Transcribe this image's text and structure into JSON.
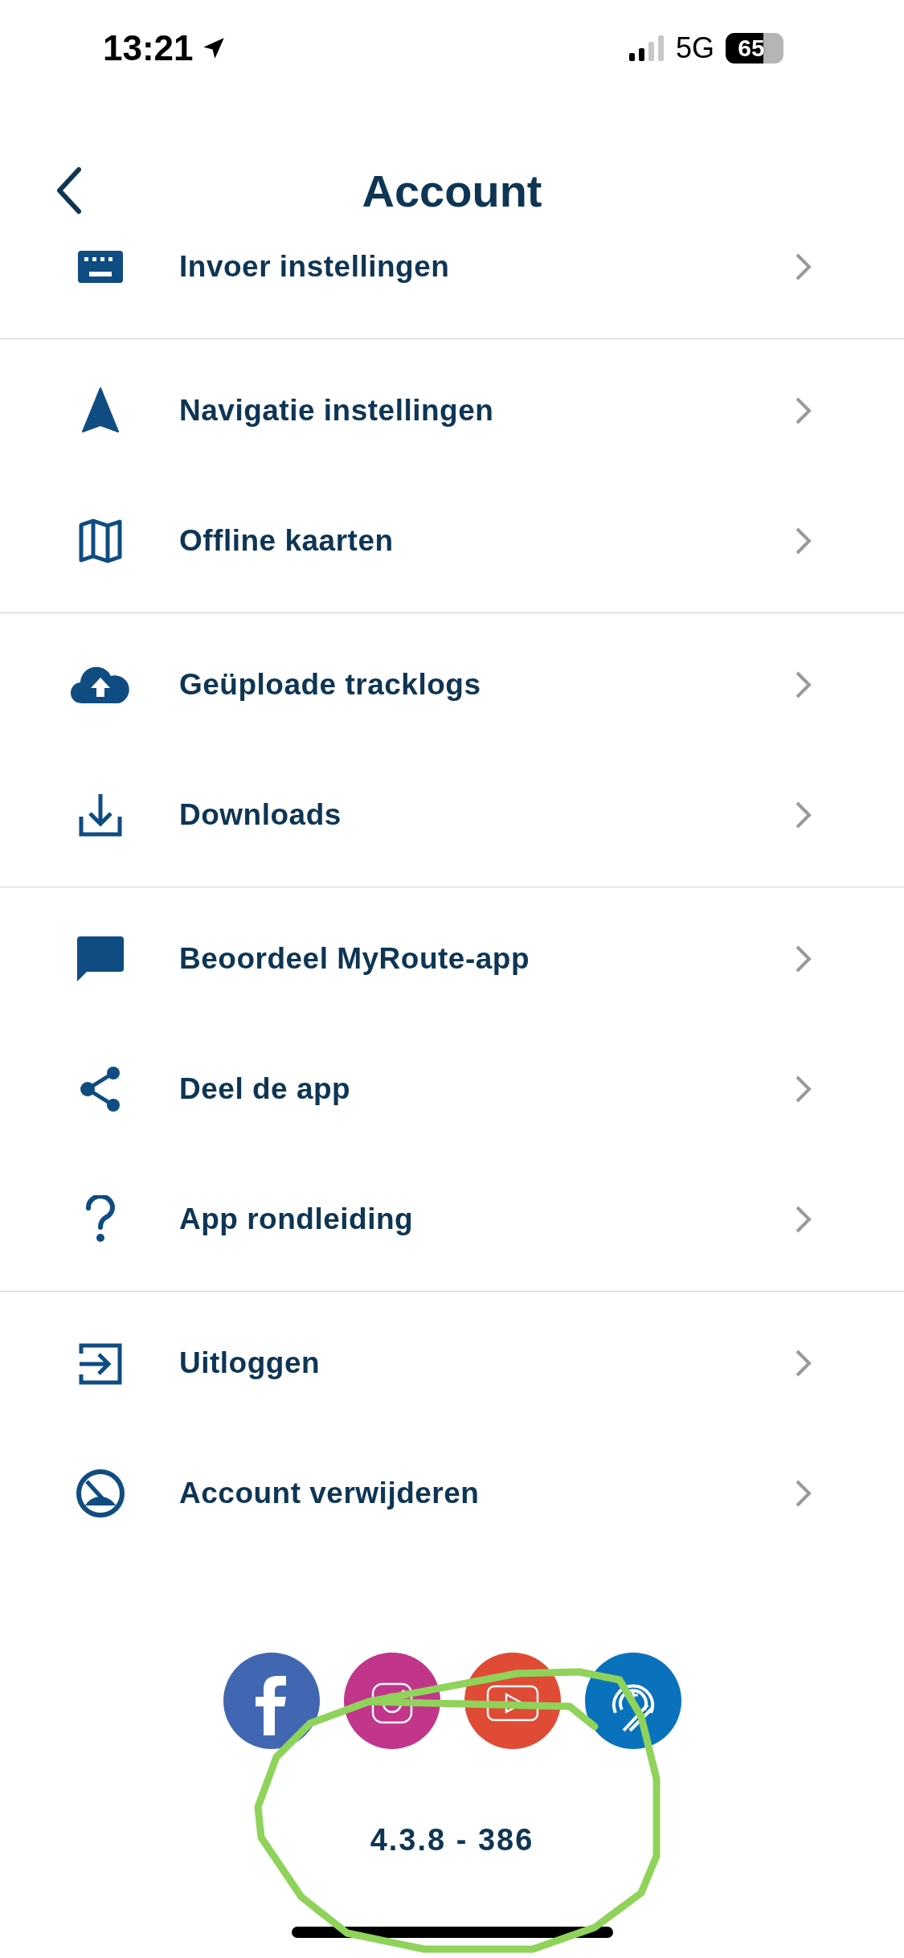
{
  "status_bar": {
    "time": "13:21",
    "network": "5G",
    "battery": "65"
  },
  "header": {
    "title": "Account"
  },
  "sections": [
    {
      "items": [
        {
          "kind": "keyboard",
          "label": "Invoer instellingen"
        }
      ]
    },
    {
      "items": [
        {
          "kind": "navigation",
          "label": "Navigatie instellingen"
        },
        {
          "kind": "map",
          "label": "Offline kaarten"
        }
      ]
    },
    {
      "items": [
        {
          "kind": "upload",
          "label": "Geüploade tracklogs"
        },
        {
          "kind": "download",
          "label": "Downloads"
        }
      ]
    },
    {
      "items": [
        {
          "kind": "chat",
          "label": "Beoordeel MyRoute-app"
        },
        {
          "kind": "share",
          "label": "Deel de app"
        },
        {
          "kind": "help",
          "label": "App rondleiding"
        }
      ]
    },
    {
      "items": [
        {
          "kind": "logout",
          "label": "Uitloggen"
        },
        {
          "kind": "delete",
          "label": "Account verwijderen"
        }
      ]
    }
  ],
  "social_links": [
    {
      "kind": "facebook"
    },
    {
      "kind": "instagram"
    },
    {
      "kind": "youtube"
    },
    {
      "kind": "myroute"
    }
  ],
  "version": "4.3.8 - 386"
}
